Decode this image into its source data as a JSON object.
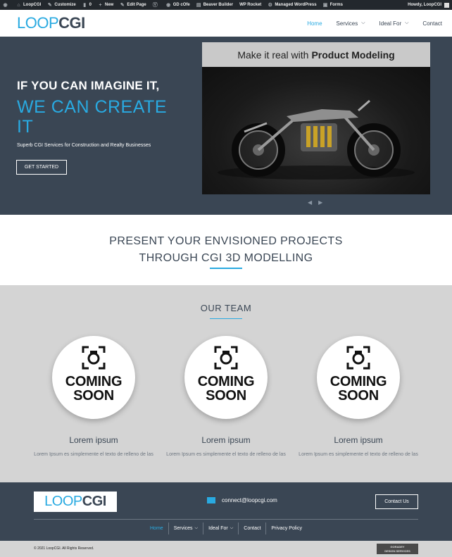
{
  "adminbar": {
    "items": [
      "LoopCGI",
      "Customize",
      "0",
      "New",
      "Edit Page",
      "",
      "GD cOfe",
      "Beaver Builder",
      "WP Rocket",
      "Managed WordPress",
      "Forms"
    ],
    "howdy": "Howdy, LoopCGI"
  },
  "header": {
    "logo_part1": "LOOP",
    "logo_part2": "CGI",
    "nav": [
      {
        "label": "Home"
      },
      {
        "label": "Services"
      },
      {
        "label": "Ideal For"
      },
      {
        "label": "Contact"
      }
    ]
  },
  "hero": {
    "line1": "IF YOU CAN IMAGINE IT,",
    "line2": "WE CAN CREATE IT",
    "subtitle": "Superb CGI Services for Construction and Realty Businesses",
    "cta": "GET STARTED",
    "slide_head_plain": "Make it real with",
    "slide_head_bold": "Product Modeling"
  },
  "present": {
    "line1": "PRESENT YOUR ENVISIONED PROJECTS",
    "line2": "THROUGH CGI 3D MODELLING"
  },
  "team": {
    "title": "OUR TEAM",
    "members": [
      {
        "coming1": "COMING",
        "coming2": "SOON",
        "name": "Lorem ipsum",
        "desc": "Lorem Ipsum es simplemente el texto de relleno de las"
      },
      {
        "coming1": "COMING",
        "coming2": "SOON",
        "name": "Lorem ipsum",
        "desc": "Lorem Ipsum es simplemente el texto de relleno de las"
      },
      {
        "coming1": "COMING",
        "coming2": "SOON",
        "name": "Lorem ipsum",
        "desc": "Lorem Ipsum es simplemente el texto de relleno de las"
      }
    ]
  },
  "footer": {
    "email": "connect@loopcgi.com",
    "contact_btn": "Contact Us",
    "nav": [
      "Home",
      "Services",
      "Ideal For",
      "Contact",
      "Privacy Policy"
    ],
    "copyright": "© 2021 LoopCGI. All Rights Reserved.",
    "badge_line1": "GORADEY",
    "badge_line2": "DESIGN SERVICES"
  },
  "colors": {
    "accent": "#29aae1",
    "dark": "#3a4654",
    "gray_section": "#d4d4d4"
  }
}
